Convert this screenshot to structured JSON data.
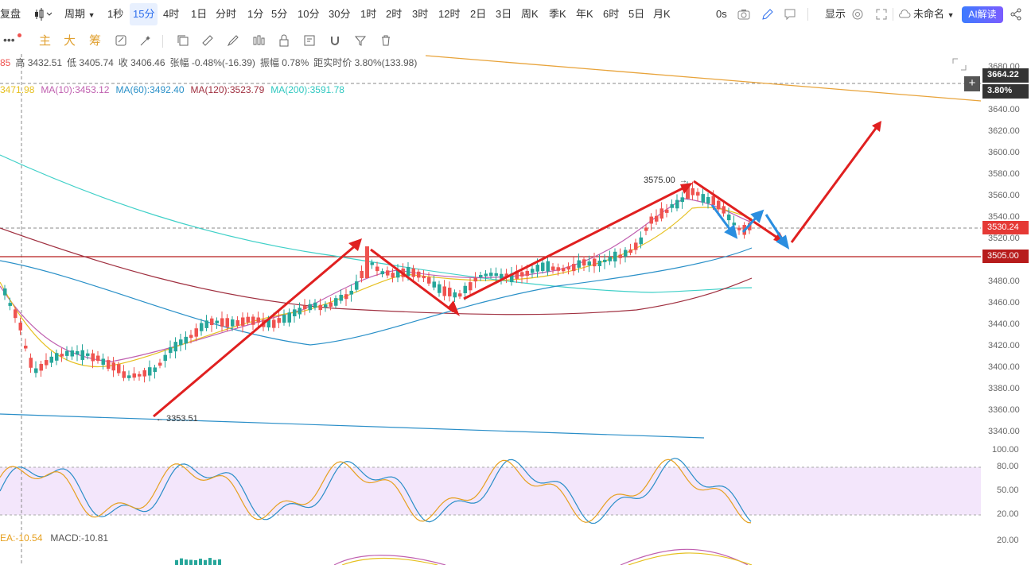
{
  "topbar": {
    "left_items": [
      "复盘",
      "周期"
    ],
    "periods": [
      "1秒",
      "15分",
      "4时",
      "1日",
      "分时",
      "1分",
      "5分",
      "10分",
      "30分",
      "1时",
      "2时",
      "3时",
      "12时",
      "2日",
      "3日",
      "周K",
      "季K",
      "年K",
      "6时",
      "5日",
      "月K"
    ],
    "active_period": "15分",
    "seconds": "0s",
    "display": "显示",
    "unnamed": "未命名",
    "ai_button": "AI解读"
  },
  "toolbar2": {
    "main": "主",
    "big": "大",
    "chip": "筹"
  },
  "info": {
    "open_partial": "85",
    "high": "高 3432.51",
    "low": "低 3405.74",
    "close": "收 3406.46",
    "change": "张幅 -0.48%(-16.39)",
    "amplitude": "振幅 0.78%",
    "distance": "距实时价 3.80%(133.98)"
  },
  "ma": {
    "ma5": "3471.98",
    "ma10": "MA(10):3453.12",
    "ma60": "MA(60):3492.40",
    "ma120": "MA(120):3523.79",
    "ma200": "MA(200):3591.78"
  },
  "axis": {
    "ticks": [
      "3680.00",
      "3640.00",
      "3620.00",
      "3600.00",
      "3580.00",
      "3560.00",
      "3540.00",
      "3520.00",
      "3480.00",
      "3460.00",
      "3440.00",
      "3420.00",
      "3400.00",
      "3380.00",
      "3360.00",
      "3340.00"
    ],
    "crosshair_price": "3664.22",
    "crosshair_pct": "3.80%",
    "current_price": "3530.24",
    "level_price": "3505.00",
    "osc_ticks": [
      "100.00",
      "80.00",
      "50.00",
      "20.00"
    ],
    "macd_tick": "20.00"
  },
  "annotations": {
    "high_label": "3575.00",
    "low_label": "3353.51"
  },
  "macd": {
    "dea": "EA:-10.54",
    "macd": "MACD:-10.81"
  },
  "colors": {
    "up": "#26a69a",
    "down": "#ef5350",
    "arrow_red": "#e02020",
    "arrow_blue": "#2a8ee0",
    "level_line": "#b71c1c",
    "osc_band": "#f1e3fb"
  }
}
